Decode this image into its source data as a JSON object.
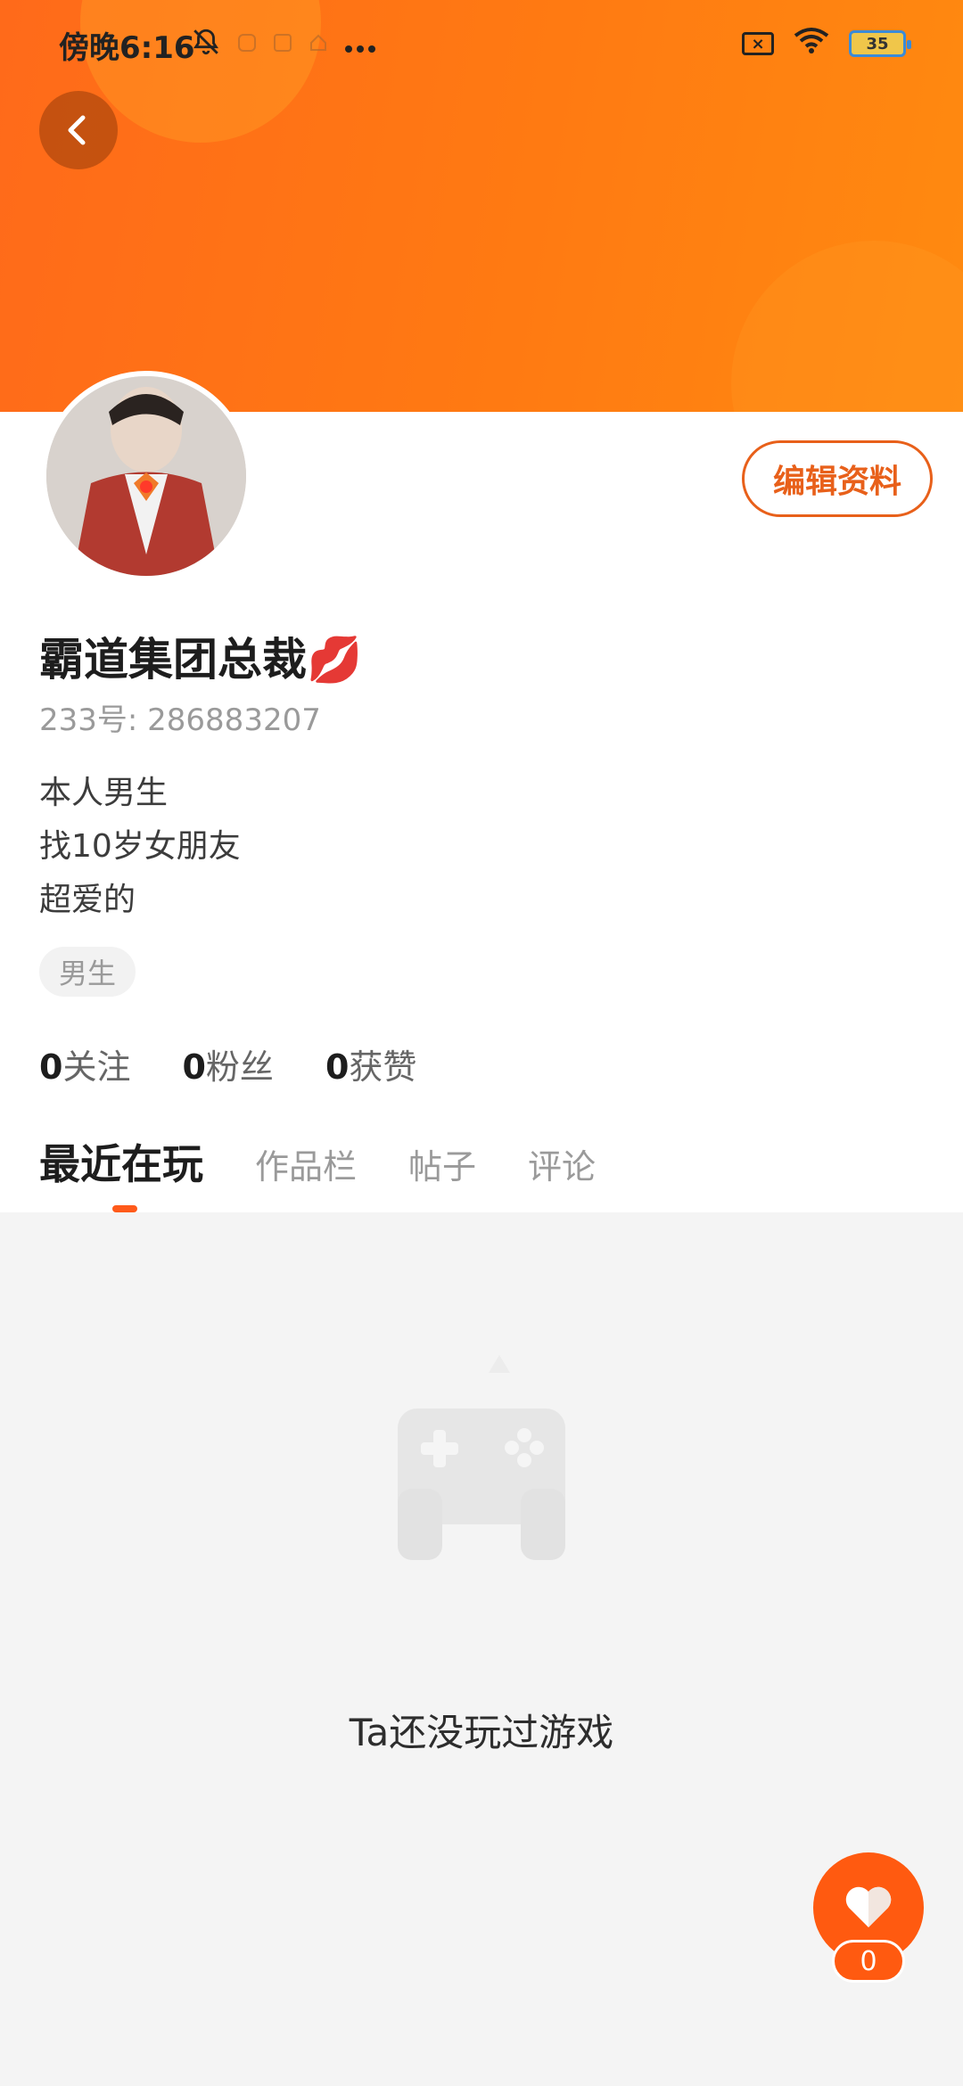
{
  "status_bar": {
    "time": "傍晚6:16",
    "battery": "35",
    "left_icons": [
      "bell-off-icon",
      "app-icon",
      "app-icon",
      "app-icon",
      "more-icon"
    ],
    "right_icons": [
      "sim-off-icon",
      "wifi-icon",
      "battery-icon"
    ]
  },
  "header": {
    "back_icon": "chevron-left-icon",
    "banner_color": "#ff7a12"
  },
  "profile": {
    "nickname": "霸道集团总裁💋",
    "uid": "233号: 286883207",
    "bio_lines": [
      "本人男生",
      "找10岁女朋友",
      "超爱的"
    ],
    "gender_tag": "男生",
    "edit_button": "编辑资料"
  },
  "stats": {
    "following": {
      "count": "0",
      "label": "关注"
    },
    "followers": {
      "count": "0",
      "label": "粉丝"
    },
    "likes": {
      "count": "0",
      "label": "获赞"
    }
  },
  "tabs": [
    {
      "label": "最近在玩",
      "active": true
    },
    {
      "label": "作品栏",
      "active": false
    },
    {
      "label": "帖子",
      "active": false
    },
    {
      "label": "评论",
      "active": false
    }
  ],
  "empty_state": {
    "icon": "gamepad-icon",
    "text": "Ta还没玩过游戏"
  },
  "like_button": {
    "icon": "heart-icon",
    "count": "0"
  },
  "colors": {
    "accent": "#ff5a10",
    "accent_border": "#e8601a"
  }
}
